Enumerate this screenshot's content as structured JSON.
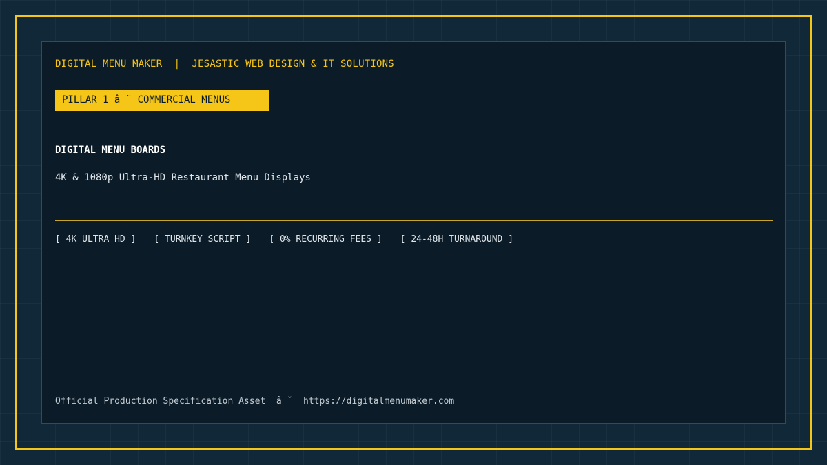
{
  "header": {
    "title": "DIGITAL MENU MAKER  |  JESASTIC WEB DESIGN & IT SOLUTIONS"
  },
  "pillar": {
    "label": "PILLAR 1 â ˘ COMMERCIAL MENUS"
  },
  "section": {
    "title": "DIGITAL MENU BOARDS",
    "subtitle": "4K & 1080p Ultra-HD Restaurant Menu Displays"
  },
  "tags": [
    "[ 4K ULTRA HD ]",
    "[ TURNKEY SCRIPT ]",
    "[ 0% RECURRING FEES ]",
    "[ 24-48H TURNAROUND ]"
  ],
  "footer": {
    "text": "Official Production Specification Asset  â ˘  https://digitalmenumaker.com"
  },
  "colors": {
    "accent": "#f5c518",
    "background": "#102838",
    "panel": "#0b1c28"
  }
}
